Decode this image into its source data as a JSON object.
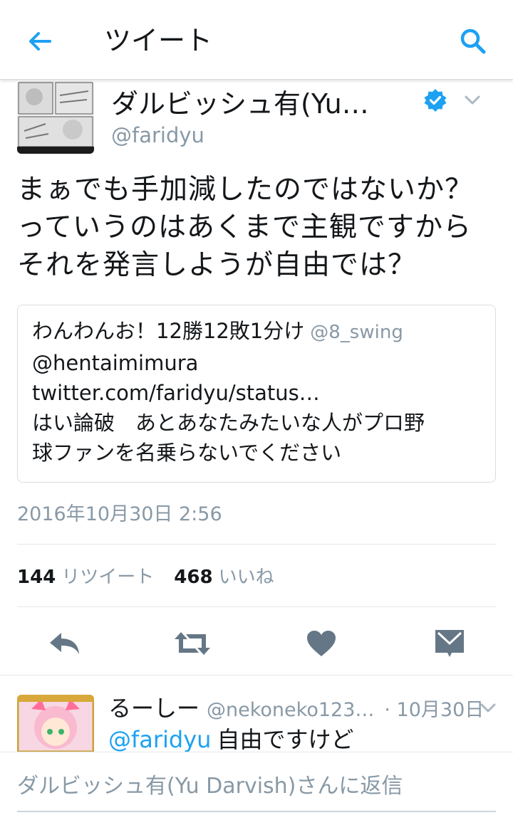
{
  "header": {
    "title": "ツイート"
  },
  "tweet": {
    "author_name": "ダルビッシュ有(Yu…",
    "author_handle": "@faridyu",
    "text_lines": [
      "まぁでも手加減したのではないか？",
      "っていうのはあくまで主観ですから",
      "それを発言しようが自由では？"
    ],
    "quote": {
      "name": "わんわんお！12勝12敗1分け",
      "handle": "@8_swing",
      "lines": [
        "@hentaimimura",
        "twitter.com/faridyu/status…",
        "はい論破　あとあなたみたいな人がプロ野",
        "球ファンを名乗らないでください"
      ]
    },
    "timestamp": "2016年10月30日 2:56",
    "retweet_count": "144",
    "retweet_label": "リツイート",
    "like_count": "468",
    "like_label": "いいね"
  },
  "reply": {
    "name": "るーしー",
    "handle": "@nekoneko123…",
    "time": "· 10月30日",
    "mention": "@faridyu",
    "text": "自由ですけど"
  },
  "compose": {
    "placeholder": "ダルビッシュ有(Yu Darvish)さんに返信"
  },
  "colors": {
    "accent": "#1da1f2",
    "muted": "#8899a6",
    "icon": "#657786"
  },
  "icons": [
    "back-arrow-icon",
    "search-icon",
    "verified-badge-icon",
    "chevron-down-icon",
    "reply-icon",
    "retweet-icon",
    "heart-icon",
    "direct-message-icon"
  ]
}
